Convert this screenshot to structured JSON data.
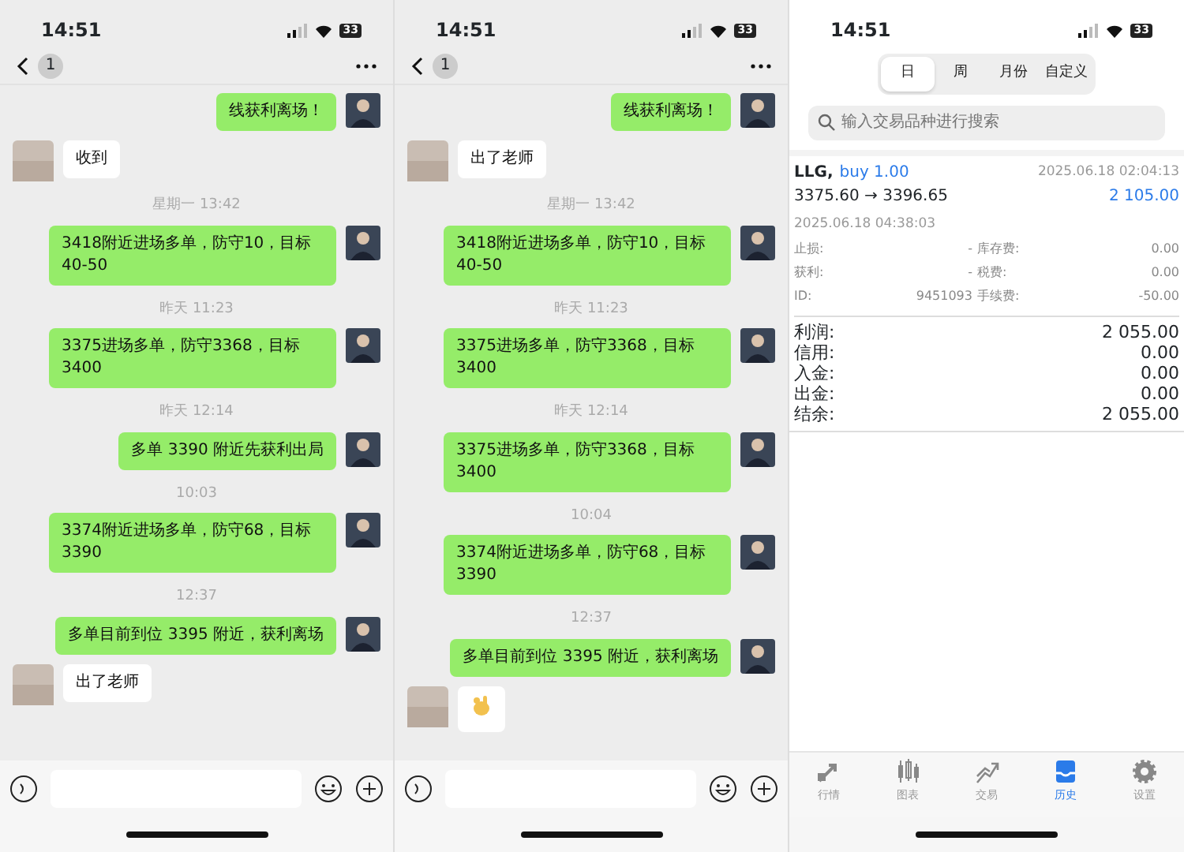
{
  "panels": [
    {
      "kind": "chat",
      "status": {
        "time": "14:51",
        "battery": "33"
      },
      "header": {
        "badge": "1"
      },
      "messages": [
        {
          "kind": "out",
          "text": "线获利离场！"
        },
        {
          "kind": "in",
          "text": "收到"
        },
        {
          "kind": "time",
          "text": "星期一 13:42"
        },
        {
          "kind": "out",
          "text": "3418附近进场多单，防守10，目标40-50"
        },
        {
          "kind": "time",
          "text": "昨天 11:23"
        },
        {
          "kind": "out",
          "text": "3375进场多单，防守3368，目标3400"
        },
        {
          "kind": "time",
          "text": "昨天 12:14"
        },
        {
          "kind": "out",
          "text": "多单 3390 附近先获利出局"
        },
        {
          "kind": "time",
          "text": "10:03"
        },
        {
          "kind": "out",
          "text": "3374附近进场多单，防守68，目标3390"
        },
        {
          "kind": "time",
          "text": "12:37"
        },
        {
          "kind": "out",
          "text": "多单目前到位 3395 附近，获利离场"
        },
        {
          "kind": "in",
          "text": "出了老师"
        }
      ]
    },
    {
      "kind": "chat",
      "status": {
        "time": "14:51",
        "battery": "33"
      },
      "header": {
        "badge": "1"
      },
      "messages": [
        {
          "kind": "out",
          "text": "线获利离场！"
        },
        {
          "kind": "in",
          "text": "出了老师"
        },
        {
          "kind": "time",
          "text": "星期一 13:42"
        },
        {
          "kind": "out",
          "text": "3418附近进场多单，防守10，目标40-50"
        },
        {
          "kind": "time",
          "text": "昨天 11:23"
        },
        {
          "kind": "out",
          "text": "3375进场多单，防守3368，目标3400"
        },
        {
          "kind": "time",
          "text": "昨天 12:14"
        },
        {
          "kind": "out",
          "text": "3375进场多单，防守3368，目标3400"
        },
        {
          "kind": "time",
          "text": "10:04"
        },
        {
          "kind": "out",
          "text": "3374附近进场多单，防守68，目标3390"
        },
        {
          "kind": "time",
          "text": "12:37"
        },
        {
          "kind": "out",
          "text": "多单目前到位 3395 附近，获利离场"
        },
        {
          "kind": "sticker"
        }
      ]
    },
    {
      "kind": "trade",
      "status": {
        "time": "14:51",
        "battery": "33"
      },
      "periods": [
        {
          "label": "日",
          "selected": true
        },
        {
          "label": "周",
          "selected": false
        },
        {
          "label": "月份",
          "selected": false
        },
        {
          "label": "自定义",
          "selected": false
        }
      ],
      "search": {
        "placeholder": "输入交易品种进行搜索"
      },
      "deal": {
        "symbol": "LLG,",
        "side": "buy 1.00",
        "open_time": "2025.06.18 02:04:13",
        "prices": "3375.60 → 3396.65",
        "profit": "2 105.00",
        "close_time": "2025.06.18 04:38:03",
        "details": [
          [
            "止损:",
            "-",
            "库存费:",
            "0.00"
          ],
          [
            "获利:",
            "-",
            "税费:",
            "0.00"
          ],
          [
            "ID:",
            "9451093",
            "手续费:",
            "-50.00"
          ]
        ]
      },
      "summary": [
        {
          "label": "利润:",
          "value": "2 055.00"
        },
        {
          "label": "信用:",
          "value": "0.00"
        },
        {
          "label": "入金:",
          "value": "0.00"
        },
        {
          "label": "出金:",
          "value": "0.00"
        },
        {
          "label": "结余:",
          "value": "2 055.00"
        }
      ],
      "tabs": [
        {
          "kind": "quotes",
          "label": "行情",
          "selected": false
        },
        {
          "kind": "chart",
          "label": "图表",
          "selected": false
        },
        {
          "kind": "trade",
          "label": "交易",
          "selected": false
        },
        {
          "kind": "history",
          "label": "历史",
          "selected": true
        },
        {
          "kind": "settings",
          "label": "设置",
          "selected": false
        }
      ]
    }
  ]
}
